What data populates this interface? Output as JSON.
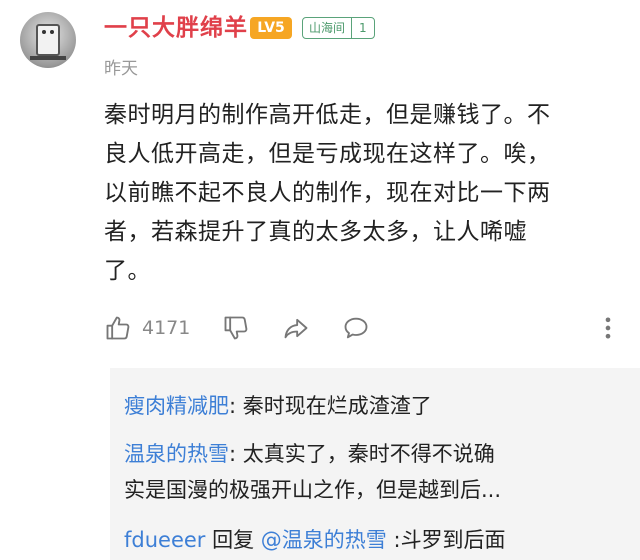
{
  "comment": {
    "username": "一只大胖绵羊",
    "level": "LV5",
    "group": {
      "name": "山海间",
      "count": "1"
    },
    "time": "昨天",
    "lines": [
      "秦时明月的制作高开低走，但是赚钱了。不",
      "良人低开高走，但是亏成现在这样了。唉，",
      "以前瞧不起不良人的制作，现在对比一下两",
      "者，若森提升了真的太多太多，让人唏嘘",
      "了。"
    ],
    "like_count": "4171"
  },
  "icons": {
    "like": "thumbs-up-icon",
    "dislike": "thumbs-down-icon",
    "share": "share-icon",
    "comment": "comment-icon",
    "more": "more-vertical-icon"
  },
  "replies": [
    {
      "name": "瘦肉精减肥",
      "sep": ": ",
      "text": "秦时现在烂成渣渣了"
    },
    {
      "name": "温泉的热雪",
      "sep": ": ",
      "text": "太真实了，秦时不得不说确",
      "text2": "实是国漫的极强开山之作，但是越到后..."
    },
    {
      "name": "fdueeer",
      "reply_word": " 回复 ",
      "at": "@温泉的热雪",
      "sep": " :",
      "text": "斗罗到后面"
    }
  ],
  "colors": {
    "username": "#e0404a",
    "level_badge": "#f6a623",
    "group_badge": "#4c9a6c",
    "reply_name": "#3d7fd6",
    "replies_bg": "#f4f4f4"
  }
}
